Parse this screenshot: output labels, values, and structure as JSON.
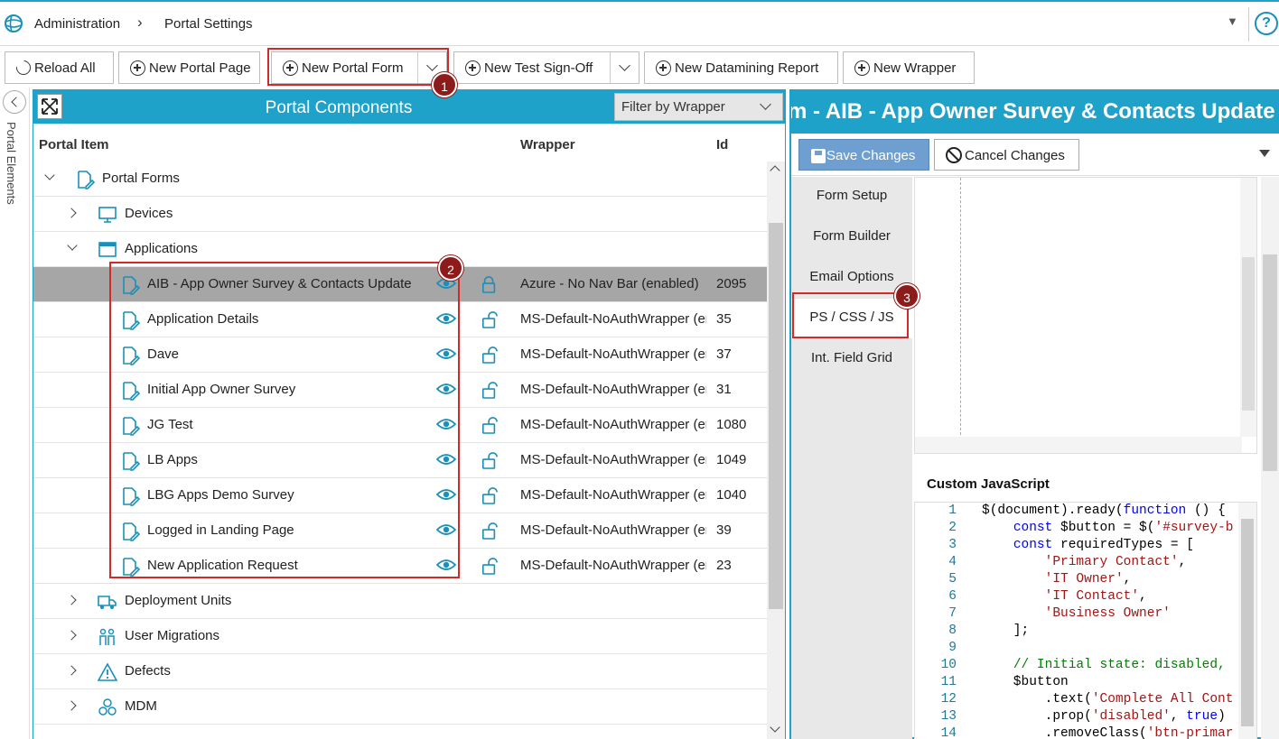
{
  "breadcrumb": {
    "root": "Administration",
    "current": "Portal Settings"
  },
  "toolbar": {
    "reload_all": "Reload All",
    "new_portal_page": "New Portal Page",
    "new_portal_form": "New Portal Form",
    "new_test_signoff": "New Test Sign-Off",
    "new_datamining_report": "New Datamining Report",
    "new_wrapper": "New Wrapper"
  },
  "side_label": "Portal Elements",
  "callouts": [
    "1",
    "2",
    "3"
  ],
  "left_panel": {
    "title": "Portal Components",
    "filter": "Filter by Wrapper",
    "columns": {
      "item": "Portal Item",
      "wrapper": "Wrapper",
      "id": "Id"
    },
    "tree": {
      "portal_forms": "Portal Forms",
      "devices": "Devices",
      "applications": "Applications",
      "forms": [
        {
          "name": "AIB - App Owner Survey & Contacts Update",
          "wrapper": "Azure - No Nav Bar (enabled)",
          "id": "2095",
          "locked": true
        },
        {
          "name": "Application Details",
          "wrapper": "MS-Default-NoAuthWrapper (enabled)",
          "id": "35",
          "locked": false
        },
        {
          "name": "Dave",
          "wrapper": "MS-Default-NoAuthWrapper (enabled)",
          "id": "37",
          "locked": false
        },
        {
          "name": "Initial App Owner Survey",
          "wrapper": "MS-Default-NoAuthWrapper (enabled)",
          "id": "31",
          "locked": false
        },
        {
          "name": "JG Test",
          "wrapper": "MS-Default-NoAuthWrapper (enabled)",
          "id": "1080",
          "locked": false
        },
        {
          "name": "LB Apps",
          "wrapper": "MS-Default-NoAuthWrapper (enabled)",
          "id": "1049",
          "locked": false
        },
        {
          "name": "LBG Apps Demo Survey",
          "wrapper": "MS-Default-NoAuthWrapper (enabled)",
          "id": "1040",
          "locked": false
        },
        {
          "name": "Logged in Landing Page",
          "wrapper": "MS-Default-NoAuthWrapper (enabled)",
          "id": "39",
          "locked": false
        },
        {
          "name": "New Application Request",
          "wrapper": "MS-Default-NoAuthWrapper (enabled)",
          "id": "23",
          "locked": false
        }
      ],
      "deployment_units": "Deployment Units",
      "user_migrations": "User Migrations",
      "defects": "Defects",
      "mdm": "MDM"
    }
  },
  "right_panel": {
    "title": "m -  AIB - App Owner Survey & Contacts Update",
    "save": "Save Changes",
    "cancel": "Cancel Changes",
    "tabs": [
      "Form Setup",
      "Form Builder",
      "Email Options",
      "PS / CSS / JS",
      "Int. Field Grid"
    ],
    "active_tab": "PS / CSS / JS",
    "custom_js_label": "Custom JavaScript",
    "code_lines": [
      {
        "n": "1",
        "html": "$(document).ready(<span class=\"kw\">function</span> () {"
      },
      {
        "n": "2",
        "html": "    <span class=\"kw\">const</span> $button = $(<span class=\"str\">'#survey-b</span>"
      },
      {
        "n": "3",
        "html": "    <span class=\"kw\">const</span> requiredTypes = ["
      },
      {
        "n": "4",
        "html": "        <span class=\"str\">'Primary Contact'</span>,"
      },
      {
        "n": "5",
        "html": "        <span class=\"str\">'IT Owner'</span>,"
      },
      {
        "n": "6",
        "html": "        <span class=\"str\">'IT Contact'</span>,"
      },
      {
        "n": "7",
        "html": "        <span class=\"str\">'Business Owner'</span>"
      },
      {
        "n": "8",
        "html": "    ];"
      },
      {
        "n": "9",
        "html": ""
      },
      {
        "n": "10",
        "html": "    <span class=\"cm\">// Initial state: disabled,</span>"
      },
      {
        "n": "11",
        "html": "    $button"
      },
      {
        "n": "12",
        "html": "        .text(<span class=\"str\">'Complete All Cont</span>"
      },
      {
        "n": "13",
        "html": "        .prop(<span class=\"str\">'disabled'</span>, <span class=\"kw\">true</span>)"
      },
      {
        "n": "14",
        "html": "        .removeClass(<span class=\"str\">'btn-primar</span>"
      }
    ]
  },
  "colors": {
    "accent": "#1ea2c9",
    "callout": "#8e1b1b",
    "highlight": "#d02a2a",
    "selected_row": "#a6a6a6",
    "save_button": "#6f9fd0"
  }
}
